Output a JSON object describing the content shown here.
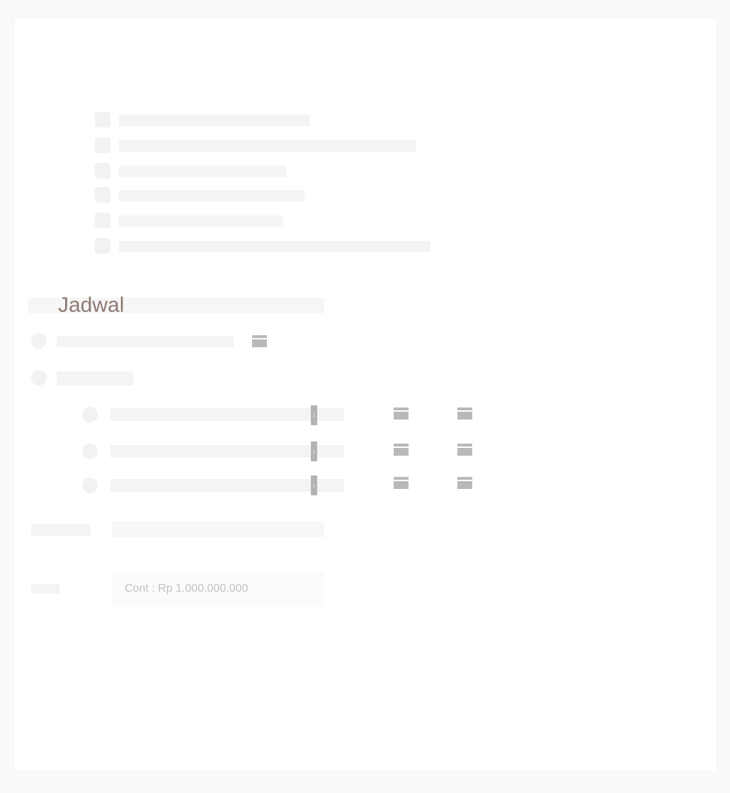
{
  "section": {
    "title": "",
    "items": [
      {
        "label": ""
      },
      {
        "label": ""
      },
      {
        "label": ""
      },
      {
        "label": ""
      },
      {
        "label": ""
      },
      {
        "label": ""
      }
    ]
  },
  "schedule": {
    "title": "Jadwal",
    "row_count": 3
  },
  "budget": {
    "value_text": "Cont : Rp 1.000.000.000"
  },
  "icons": {
    "calendar": "calendar-icon",
    "download": "download-icon"
  },
  "colors": {
    "heading": "#8c7b73",
    "icon": "#b9b9b9",
    "placeholder": "#c2c2c2"
  }
}
